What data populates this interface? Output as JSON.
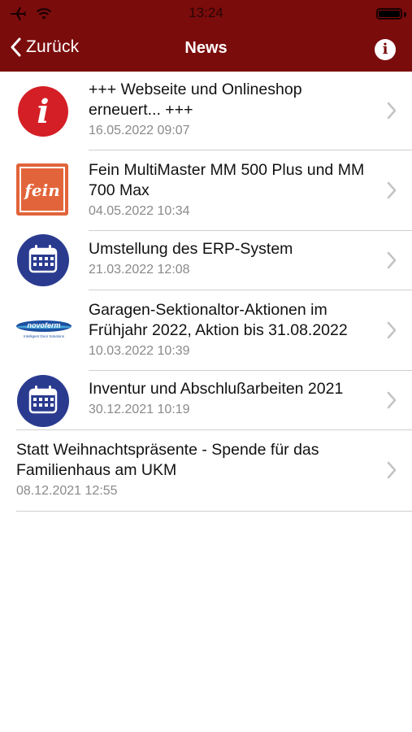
{
  "status_bar": {
    "time": "13:24",
    "icons": [
      "airplane-icon",
      "wifi-icon",
      "battery-icon"
    ]
  },
  "nav": {
    "back_label": "Zurück",
    "title": "News",
    "info_icon": "i"
  },
  "colors": {
    "header": "#7b0c0c",
    "info_red": "#d41f26",
    "fein_orange": "#e2643a",
    "calendar_blue": "#2a3b8f",
    "novoferm_blue": "#1c4fa0"
  },
  "news": [
    {
      "icon": "info-icon",
      "title": "+++ Webseite und Onlineshop erneuert... +++",
      "date": "16.05.2022 09:07"
    },
    {
      "icon": "fein-logo",
      "title": "Fein MultiMaster MM 500 Plus und MM 700 Max",
      "date": "04.05.2022 10:34"
    },
    {
      "icon": "calendar-icon",
      "title": "Umstellung des ERP-System",
      "date": "21.03.2022 12:08"
    },
    {
      "icon": "novoferm-logo",
      "title": "Garagen-Sektionaltor-Aktionen im Frühjahr 2022, Aktion bis 31.08.2022",
      "date": "10.03.2022 10:39"
    },
    {
      "icon": "calendar-icon",
      "title": "Inventur und Abschlußarbeiten 2021",
      "date": "30.12.2021 10:19"
    },
    {
      "icon": "",
      "title": "Statt Weihnachtspräsente - Spende für das Familienhaus am UKM",
      "date": "08.12.2021 12:55"
    }
  ],
  "logos": {
    "fein": "fein",
    "novoferm": "novoferm",
    "novoferm_tagline": "Intelligent Door Solutions"
  }
}
